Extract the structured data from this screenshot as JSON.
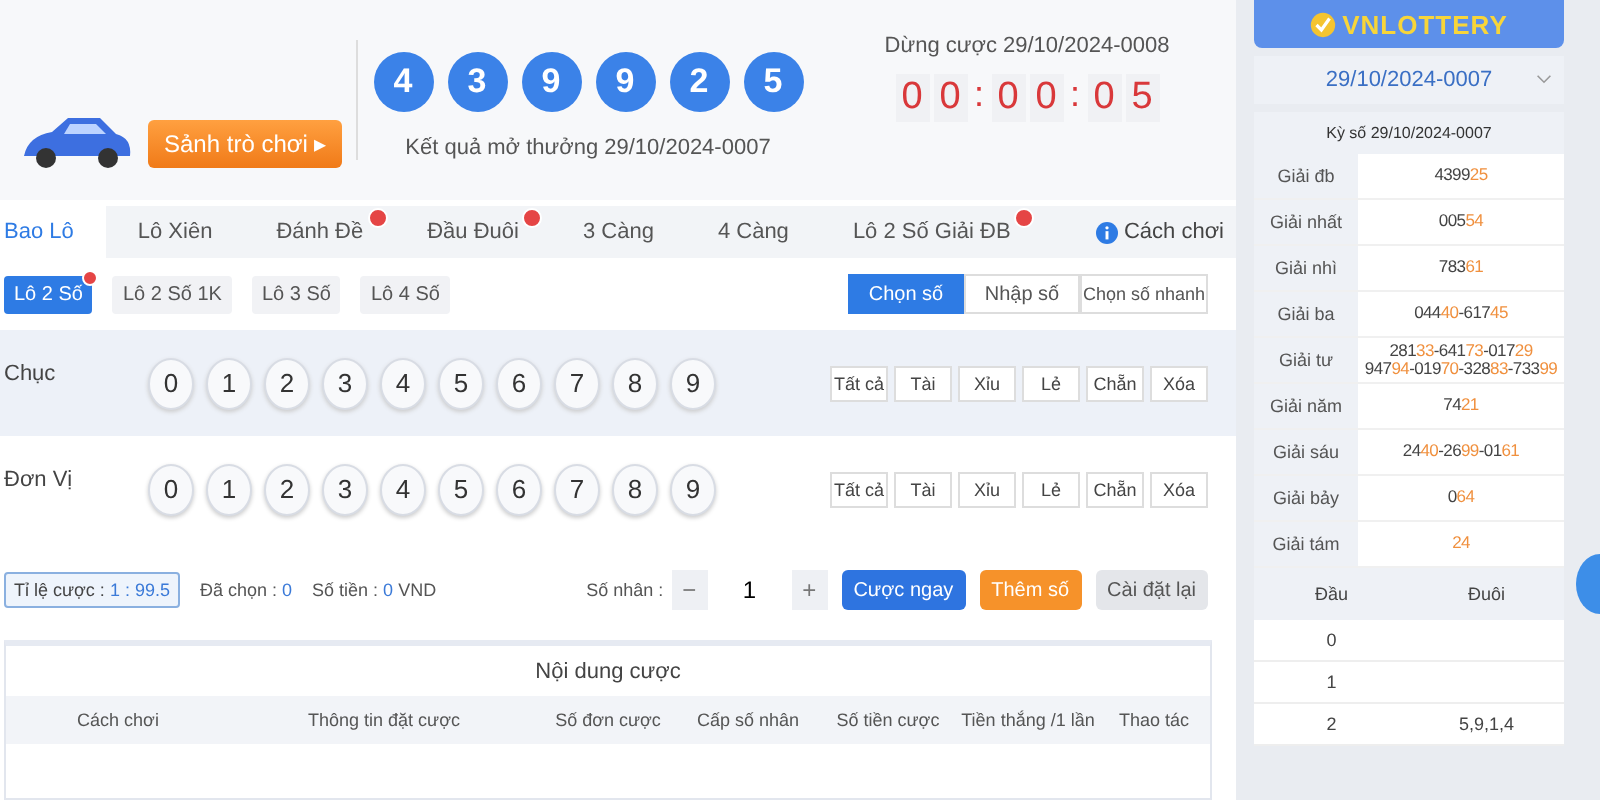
{
  "header": {
    "lobby_button": "Sảnh trò chơi",
    "lobby_arrow": "▸",
    "result_balls": [
      "4",
      "3",
      "9",
      "9",
      "2",
      "5"
    ],
    "result_caption": "Kết quả mở thưởng 29/10/2024-0007",
    "stop_caption": "Dừng cược 29/10/2024-0008",
    "countdown": [
      "0",
      "0",
      ":",
      "0",
      "0",
      ":",
      "0",
      "5"
    ]
  },
  "tabs": [
    {
      "label": "Bao Lô",
      "selected": true,
      "hot": false
    },
    {
      "label": "Lô Xiên",
      "selected": false,
      "hot": false
    },
    {
      "label": "Đánh Đề",
      "selected": false,
      "hot": true
    },
    {
      "label": "Đầu Đuôi",
      "selected": false,
      "hot": true
    },
    {
      "label": "3 Càng",
      "selected": false,
      "hot": false
    },
    {
      "label": "4 Càng",
      "selected": false,
      "hot": false
    },
    {
      "label": "Lô 2 Số Giải ĐB",
      "selected": false,
      "hot": true
    }
  ],
  "help_link": "Cách chơi",
  "subtabs": [
    {
      "label": "Lô 2 Số",
      "selected": true,
      "hot": true
    },
    {
      "label": "Lô 2 Số 1K",
      "selected": false,
      "hot": false
    },
    {
      "label": "Lô 3 Số",
      "selected": false,
      "hot": false
    },
    {
      "label": "Lô 4 Số",
      "selected": false,
      "hot": false
    }
  ],
  "modes": [
    {
      "label": "Chọn số",
      "selected": true
    },
    {
      "label": "Nhập số",
      "selected": false
    },
    {
      "label": "Chọn số nhanh",
      "selected": false
    }
  ],
  "pick_rows": [
    {
      "label": "Chục",
      "digits": [
        "0",
        "1",
        "2",
        "3",
        "4",
        "5",
        "6",
        "7",
        "8",
        "9"
      ],
      "quick": [
        "Tất cả",
        "Tài",
        "Xỉu",
        "Lẻ",
        "Chẵn",
        "Xóa"
      ]
    },
    {
      "label": "Đơn Vị",
      "digits": [
        "0",
        "1",
        "2",
        "3",
        "4",
        "5",
        "6",
        "7",
        "8",
        "9"
      ],
      "quick": [
        "Tất cả",
        "Tài",
        "Xỉu",
        "Lẻ",
        "Chẵn",
        "Xóa"
      ]
    }
  ],
  "bet_bar": {
    "odds_label": "Tỉ lệ cược :",
    "odds_value": "1 : 99.5",
    "selected_label": "Đã chọn :",
    "selected_value": "0",
    "amount_label": "Số tiền :",
    "amount_value": "0",
    "amount_unit": "VND",
    "multiplier_label": "Số nhân :",
    "minus": "−",
    "multiplier": "1",
    "plus": "+",
    "bet_button": "Cược ngay",
    "add_button": "Thêm số",
    "reset_button": "Cài đặt lại"
  },
  "bet_table": {
    "title": "Nội dung cược",
    "columns": [
      "Cách chơi",
      "Thông tin đặt cược",
      "Số đơn cược",
      "Cấp số nhân",
      "Số tiền cược",
      "Tiền thắng /1 lần",
      "Thao tác"
    ]
  },
  "sidebar": {
    "logo": "VNLOTTERY",
    "draw_select": "29/10/2024-0007",
    "draw_title": "Kỳ số 29/10/2024-0007",
    "prizes": [
      {
        "name": "Giải đb",
        "lines": [
          [
            {
              "head": "4399",
              "tail": "25"
            }
          ]
        ]
      },
      {
        "name": "Giải nhất",
        "lines": [
          [
            {
              "head": "005",
              "tail": "54"
            }
          ]
        ]
      },
      {
        "name": "Giải nhì",
        "lines": [
          [
            {
              "head": "783",
              "tail": "61"
            }
          ]
        ]
      },
      {
        "name": "Giải ba",
        "lines": [
          [
            {
              "head": "044",
              "tail": "40"
            },
            {
              "head": "-617",
              "tail": "45"
            }
          ]
        ]
      },
      {
        "name": "Giải tư",
        "lines": [
          [
            {
              "head": "281",
              "tail": "33"
            },
            {
              "head": "-641",
              "tail": "73"
            },
            {
              "head": "-017",
              "tail": "29"
            }
          ],
          [
            {
              "head": "947",
              "tail": "94"
            },
            {
              "head": "-019",
              "tail": "70"
            },
            {
              "head": "-328",
              "tail": "83"
            },
            {
              "head": "-733",
              "tail": "99"
            }
          ]
        ]
      },
      {
        "name": "Giải năm",
        "lines": [
          [
            {
              "head": "74",
              "tail": "21"
            }
          ]
        ]
      },
      {
        "name": "Giải sáu",
        "lines": [
          [
            {
              "head": "24",
              "tail": "40"
            },
            {
              "head": "-26",
              "tail": "99"
            },
            {
              "head": "-01",
              "tail": "61"
            }
          ]
        ]
      },
      {
        "name": "Giải bảy",
        "lines": [
          [
            {
              "head": "0",
              "tail": "64"
            }
          ]
        ]
      },
      {
        "name": "Giải tám",
        "lines": [
          [
            {
              "tail": "24"
            }
          ]
        ]
      }
    ],
    "headtail_columns": [
      "Đầu",
      "Đuôi"
    ],
    "headtail_rows": [
      {
        "head": "0"
      },
      {
        "head": "1"
      },
      {
        "head": "2",
        "tails": "5,9,1,4"
      }
    ]
  }
}
